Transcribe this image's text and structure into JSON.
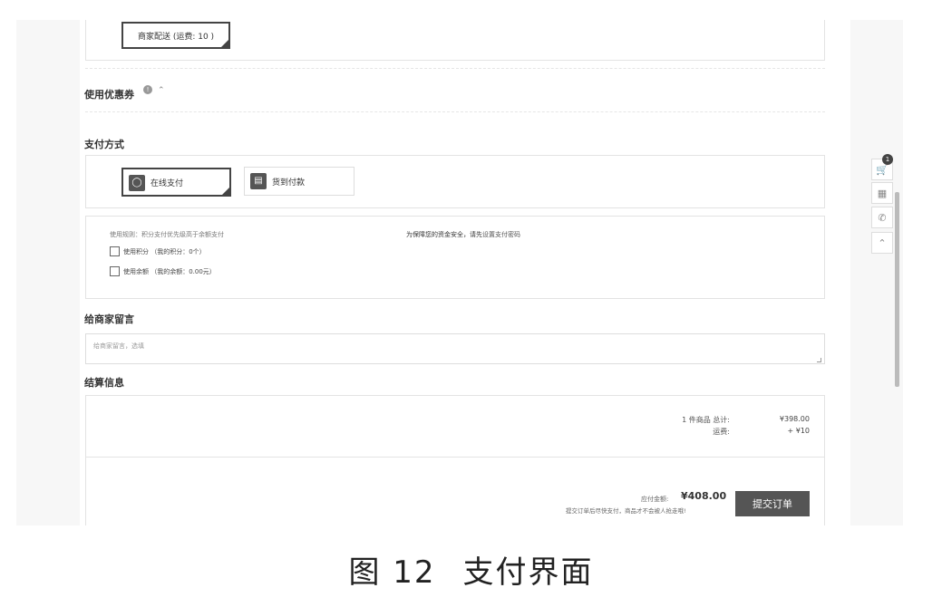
{
  "shipping": {
    "option_label": "商家配送 (运费: 10 )"
  },
  "coupon": {
    "title": "使用优惠券",
    "info_icon": "info-icon",
    "chevron_icon": "chevron-up-icon"
  },
  "payment": {
    "title": "支付方式",
    "methods": [
      {
        "label": "在线支付",
        "icon": "online-pay-icon",
        "selected": true
      },
      {
        "label": "货到付款",
        "icon": "truck-icon",
        "selected": false
      }
    ],
    "rules_text": "使用规则：积分支付优先级高于余额支付",
    "use_points_label": "使用积分 （我的积分：0个）",
    "use_balance_label": "使用余额 （我的余额：0.00元）",
    "security_text": "为保障您的资金安全，请先",
    "security_link": "设置支付密码"
  },
  "message": {
    "title": "给商家留言",
    "placeholder": "给商家留言，选填"
  },
  "settlement": {
    "title": "结算信息",
    "goods_total_label": "1 件商品 总计:",
    "goods_total_value": "¥398.00",
    "shipping_label": "运费:",
    "shipping_value": "+ ¥10",
    "payable_label": "应付金额:",
    "payable_amount": "¥408.00",
    "hint": "提交订单后尽快支付，商品才不会被人抢走哦!",
    "submit_label": "提交订单"
  },
  "sidebar_tools": {
    "cart_badge": "1"
  },
  "caption": {
    "figure": "图 12",
    "title": "支付界面"
  }
}
